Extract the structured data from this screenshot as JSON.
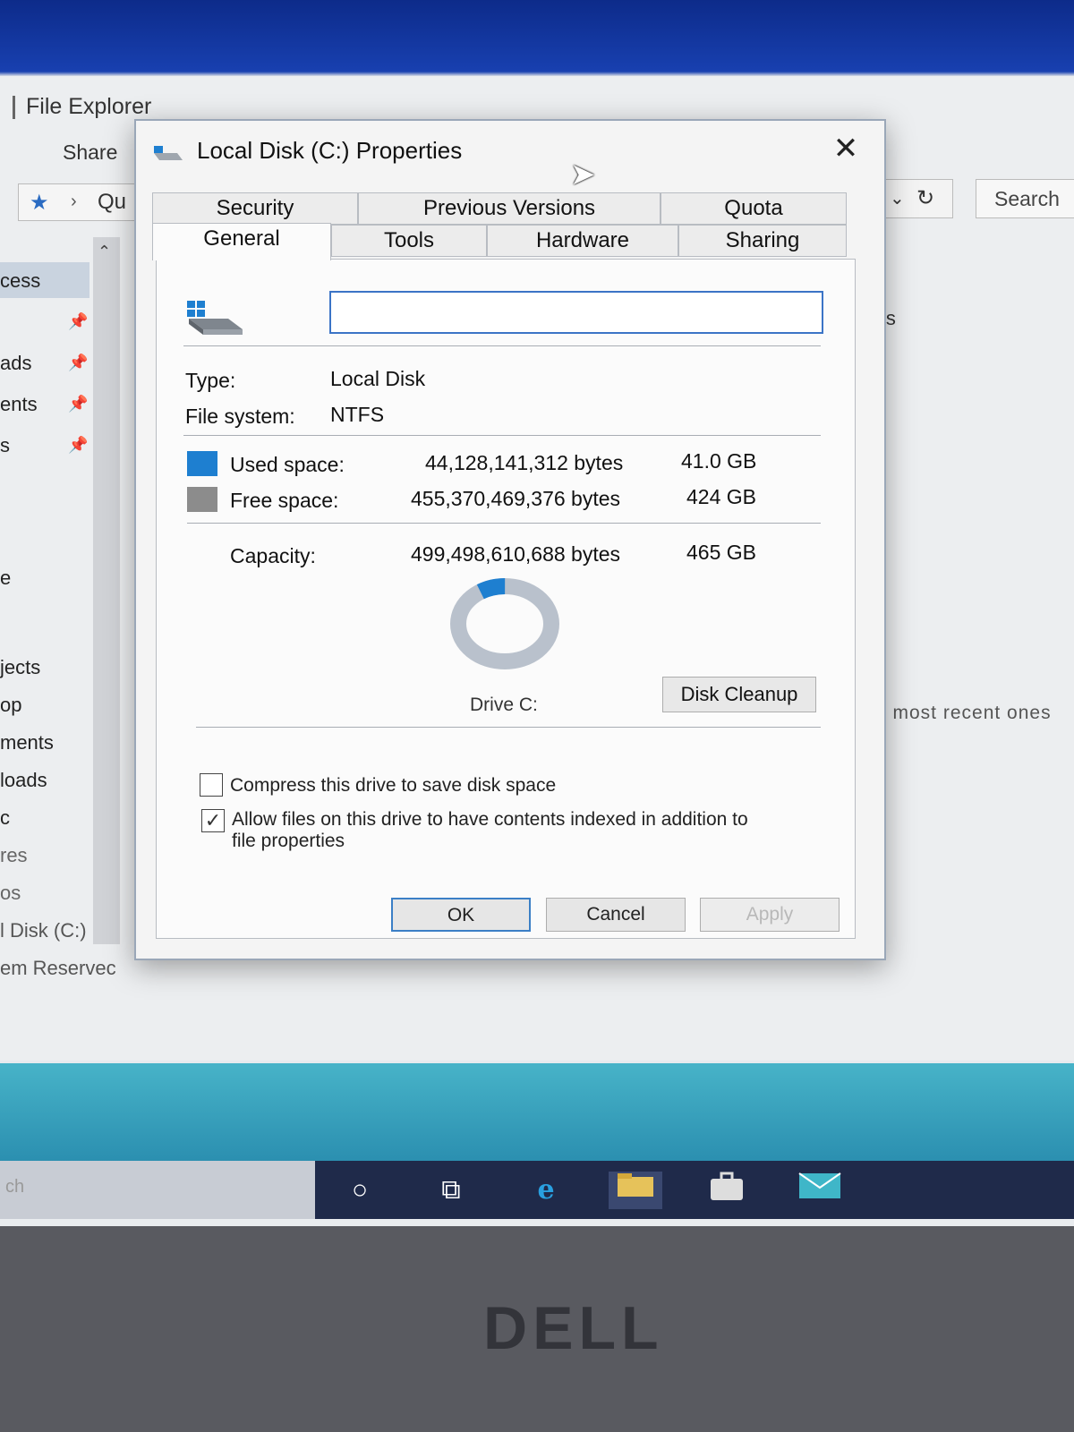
{
  "explorer": {
    "title": "File Explorer",
    "ribbon_share": "Share",
    "address_text": "Qu",
    "search_label": "Search",
    "right_snippet": "ls",
    "recent_text": "e most recent ones",
    "nav_items": [
      {
        "label": "cess"
      },
      {
        "label": ""
      },
      {
        "label": "ads"
      },
      {
        "label": "ents"
      },
      {
        "label": "s"
      },
      {
        "label": "e"
      },
      {
        "label": "jects"
      },
      {
        "label": "op"
      },
      {
        "label": "ments"
      },
      {
        "label": "loads"
      },
      {
        "label": "c"
      },
      {
        "label": "res"
      },
      {
        "label": "os"
      },
      {
        "label": "l Disk (C:)"
      },
      {
        "label": "em Reservec"
      }
    ]
  },
  "taskbar": {
    "search_text": "ch"
  },
  "bezel": {
    "brand": "DELL"
  },
  "dialog": {
    "title": "Local Disk (C:) Properties",
    "close_glyph": "✕",
    "tabs_row1": [
      "Security",
      "Previous Versions",
      "Quota"
    ],
    "tabs_row2": [
      "General",
      "Tools",
      "Hardware",
      "Sharing"
    ],
    "active_tab": "General",
    "name_value": "",
    "type_label": "Type:",
    "type_value": "Local Disk",
    "fs_label": "File system:",
    "fs_value": "NTFS",
    "used_label": "Used space:",
    "used_bytes": "44,128,141,312 bytes",
    "used_gb": "41.0 GB",
    "free_label": "Free space:",
    "free_bytes": "455,370,469,376 bytes",
    "free_gb": "424 GB",
    "capacity_label": "Capacity:",
    "capacity_bytes": "499,498,610,688 bytes",
    "capacity_gb": "465 GB",
    "used_fraction": 0.088,
    "used_color": "#1e7fd0",
    "free_color": "#8c8c8c",
    "drive_label": "Drive C:",
    "cleanup_button": "Disk Cleanup",
    "compress_label": "Compress this drive to save disk space",
    "compress_checked": false,
    "index_label_line1": "Allow files on this drive to have contents indexed in addition to",
    "index_label_line2": "file properties",
    "index_checked": true,
    "ok_button": "OK",
    "cancel_button": "Cancel",
    "apply_button": "Apply"
  }
}
